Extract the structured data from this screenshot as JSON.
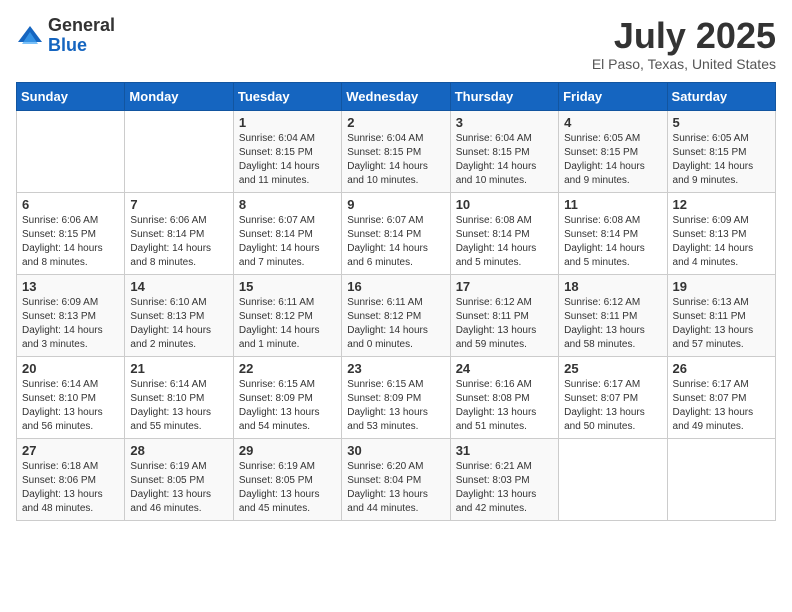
{
  "header": {
    "logo_general": "General",
    "logo_blue": "Blue",
    "month_title": "July 2025",
    "location": "El Paso, Texas, United States"
  },
  "weekdays": [
    "Sunday",
    "Monday",
    "Tuesday",
    "Wednesday",
    "Thursday",
    "Friday",
    "Saturday"
  ],
  "weeks": [
    [
      {
        "day": "",
        "info": ""
      },
      {
        "day": "",
        "info": ""
      },
      {
        "day": "1",
        "info": "Sunrise: 6:04 AM\nSunset: 8:15 PM\nDaylight: 14 hours and 11 minutes."
      },
      {
        "day": "2",
        "info": "Sunrise: 6:04 AM\nSunset: 8:15 PM\nDaylight: 14 hours and 10 minutes."
      },
      {
        "day": "3",
        "info": "Sunrise: 6:04 AM\nSunset: 8:15 PM\nDaylight: 14 hours and 10 minutes."
      },
      {
        "day": "4",
        "info": "Sunrise: 6:05 AM\nSunset: 8:15 PM\nDaylight: 14 hours and 9 minutes."
      },
      {
        "day": "5",
        "info": "Sunrise: 6:05 AM\nSunset: 8:15 PM\nDaylight: 14 hours and 9 minutes."
      }
    ],
    [
      {
        "day": "6",
        "info": "Sunrise: 6:06 AM\nSunset: 8:15 PM\nDaylight: 14 hours and 8 minutes."
      },
      {
        "day": "7",
        "info": "Sunrise: 6:06 AM\nSunset: 8:14 PM\nDaylight: 14 hours and 8 minutes."
      },
      {
        "day": "8",
        "info": "Sunrise: 6:07 AM\nSunset: 8:14 PM\nDaylight: 14 hours and 7 minutes."
      },
      {
        "day": "9",
        "info": "Sunrise: 6:07 AM\nSunset: 8:14 PM\nDaylight: 14 hours and 6 minutes."
      },
      {
        "day": "10",
        "info": "Sunrise: 6:08 AM\nSunset: 8:14 PM\nDaylight: 14 hours and 5 minutes."
      },
      {
        "day": "11",
        "info": "Sunrise: 6:08 AM\nSunset: 8:14 PM\nDaylight: 14 hours and 5 minutes."
      },
      {
        "day": "12",
        "info": "Sunrise: 6:09 AM\nSunset: 8:13 PM\nDaylight: 14 hours and 4 minutes."
      }
    ],
    [
      {
        "day": "13",
        "info": "Sunrise: 6:09 AM\nSunset: 8:13 PM\nDaylight: 14 hours and 3 minutes."
      },
      {
        "day": "14",
        "info": "Sunrise: 6:10 AM\nSunset: 8:13 PM\nDaylight: 14 hours and 2 minutes."
      },
      {
        "day": "15",
        "info": "Sunrise: 6:11 AM\nSunset: 8:12 PM\nDaylight: 14 hours and 1 minute."
      },
      {
        "day": "16",
        "info": "Sunrise: 6:11 AM\nSunset: 8:12 PM\nDaylight: 14 hours and 0 minutes."
      },
      {
        "day": "17",
        "info": "Sunrise: 6:12 AM\nSunset: 8:11 PM\nDaylight: 13 hours and 59 minutes."
      },
      {
        "day": "18",
        "info": "Sunrise: 6:12 AM\nSunset: 8:11 PM\nDaylight: 13 hours and 58 minutes."
      },
      {
        "day": "19",
        "info": "Sunrise: 6:13 AM\nSunset: 8:11 PM\nDaylight: 13 hours and 57 minutes."
      }
    ],
    [
      {
        "day": "20",
        "info": "Sunrise: 6:14 AM\nSunset: 8:10 PM\nDaylight: 13 hours and 56 minutes."
      },
      {
        "day": "21",
        "info": "Sunrise: 6:14 AM\nSunset: 8:10 PM\nDaylight: 13 hours and 55 minutes."
      },
      {
        "day": "22",
        "info": "Sunrise: 6:15 AM\nSunset: 8:09 PM\nDaylight: 13 hours and 54 minutes."
      },
      {
        "day": "23",
        "info": "Sunrise: 6:15 AM\nSunset: 8:09 PM\nDaylight: 13 hours and 53 minutes."
      },
      {
        "day": "24",
        "info": "Sunrise: 6:16 AM\nSunset: 8:08 PM\nDaylight: 13 hours and 51 minutes."
      },
      {
        "day": "25",
        "info": "Sunrise: 6:17 AM\nSunset: 8:07 PM\nDaylight: 13 hours and 50 minutes."
      },
      {
        "day": "26",
        "info": "Sunrise: 6:17 AM\nSunset: 8:07 PM\nDaylight: 13 hours and 49 minutes."
      }
    ],
    [
      {
        "day": "27",
        "info": "Sunrise: 6:18 AM\nSunset: 8:06 PM\nDaylight: 13 hours and 48 minutes."
      },
      {
        "day": "28",
        "info": "Sunrise: 6:19 AM\nSunset: 8:05 PM\nDaylight: 13 hours and 46 minutes."
      },
      {
        "day": "29",
        "info": "Sunrise: 6:19 AM\nSunset: 8:05 PM\nDaylight: 13 hours and 45 minutes."
      },
      {
        "day": "30",
        "info": "Sunrise: 6:20 AM\nSunset: 8:04 PM\nDaylight: 13 hours and 44 minutes."
      },
      {
        "day": "31",
        "info": "Sunrise: 6:21 AM\nSunset: 8:03 PM\nDaylight: 13 hours and 42 minutes."
      },
      {
        "day": "",
        "info": ""
      },
      {
        "day": "",
        "info": ""
      }
    ]
  ]
}
